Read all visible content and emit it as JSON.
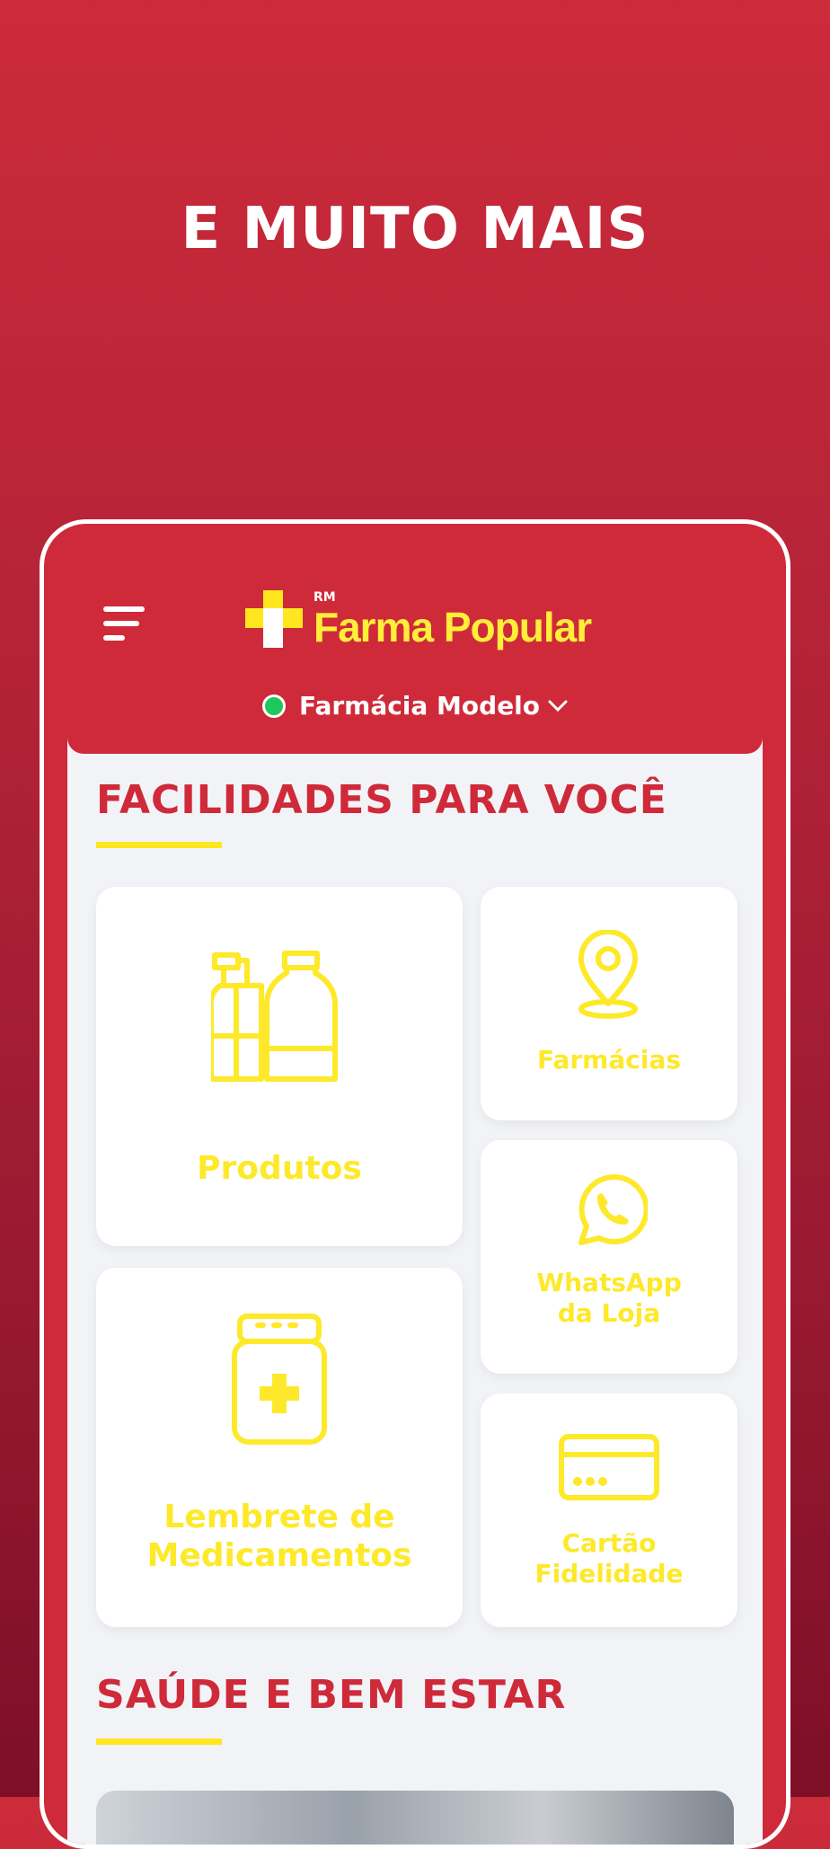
{
  "headline": "E MUITO MAIS",
  "app": {
    "logo_prefix": "RM",
    "logo_name": "Farma Popular",
    "store_name": "Farmácia Modelo"
  },
  "sections": {
    "facilities_title": "FACILIDADES PARA VOCÊ",
    "health_title": "SAÚDE E BEM ESTAR"
  },
  "cards": {
    "products": "Produtos",
    "pharmacies": "Farmácias",
    "whatsapp_line1": "WhatsApp",
    "whatsapp_line2": "da Loja",
    "reminder_line1": "Lembrete de",
    "reminder_line2": "Medicamentos",
    "loyalty_line1": "Cartão",
    "loyalty_line2": "Fidelidade"
  },
  "colors": {
    "brand_red": "#cf2a3a",
    "brand_yellow": "#fde92a",
    "status_online": "#1ec85a"
  }
}
